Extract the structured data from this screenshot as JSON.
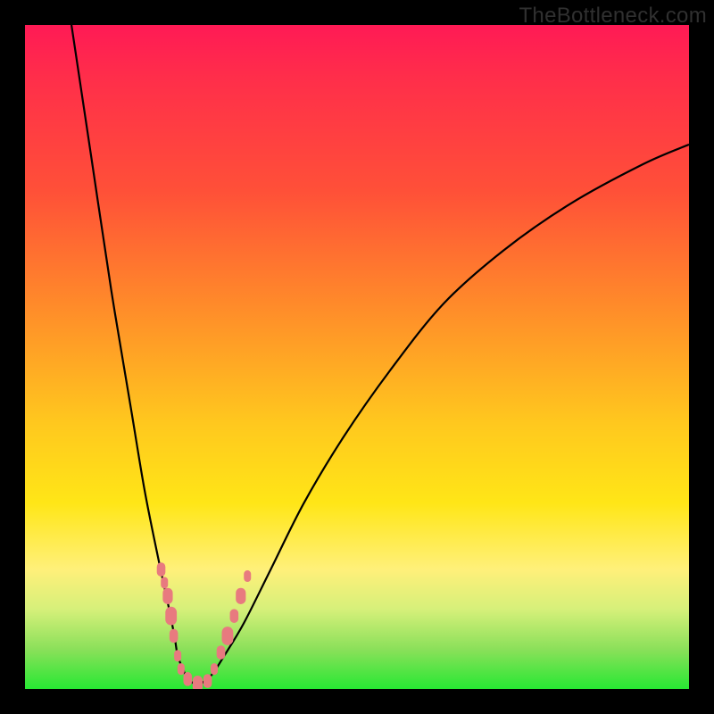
{
  "watermark": "TheBottleneck.com",
  "chart_data": {
    "type": "line",
    "title": "",
    "xlabel": "",
    "ylabel": "",
    "xlim": [
      0,
      100
    ],
    "ylim": [
      0,
      100
    ],
    "grid": false,
    "legend": false,
    "series": [
      {
        "name": "left-branch",
        "x": [
          7,
          10,
          13,
          16,
          18,
          20,
          21.5,
          22.5,
          23,
          23.8,
          24.5,
          26
        ],
        "values": [
          100,
          80,
          60,
          42,
          30,
          20,
          13,
          8,
          5,
          3,
          1.5,
          0.5
        ]
      },
      {
        "name": "right-branch",
        "x": [
          26,
          28,
          30,
          33,
          37,
          42,
          48,
          55,
          63,
          72,
          82,
          93,
          100
        ],
        "values": [
          0.5,
          2,
          5,
          10,
          18,
          28,
          38,
          48,
          58,
          66,
          73,
          79,
          82
        ]
      }
    ],
    "markers": {
      "name": "data-points",
      "color": "#e87a7f",
      "points": [
        {
          "x": 20.5,
          "y": 18,
          "s": 6
        },
        {
          "x": 21.0,
          "y": 16,
          "s": 5
        },
        {
          "x": 21.5,
          "y": 14,
          "s": 7
        },
        {
          "x": 22.0,
          "y": 11,
          "s": 8
        },
        {
          "x": 22.4,
          "y": 8,
          "s": 6
        },
        {
          "x": 23.0,
          "y": 5,
          "s": 5
        },
        {
          "x": 23.5,
          "y": 3,
          "s": 5
        },
        {
          "x": 24.5,
          "y": 1.5,
          "s": 6
        },
        {
          "x": 26.0,
          "y": 0.8,
          "s": 7
        },
        {
          "x": 27.5,
          "y": 1.2,
          "s": 6
        },
        {
          "x": 28.5,
          "y": 3,
          "s": 5
        },
        {
          "x": 29.5,
          "y": 5.5,
          "s": 6
        },
        {
          "x": 30.5,
          "y": 8,
          "s": 8
        },
        {
          "x": 31.5,
          "y": 11,
          "s": 6
        },
        {
          "x": 32.5,
          "y": 14,
          "s": 7
        },
        {
          "x": 33.5,
          "y": 17,
          "s": 5
        }
      ]
    },
    "gradient_stops": [
      {
        "pos": 0,
        "color": "#ff1a55"
      },
      {
        "pos": 8,
        "color": "#ff2e4a"
      },
      {
        "pos": 25,
        "color": "#ff5038"
      },
      {
        "pos": 42,
        "color": "#ff8a2a"
      },
      {
        "pos": 60,
        "color": "#ffc81e"
      },
      {
        "pos": 72,
        "color": "#ffe617"
      },
      {
        "pos": 82,
        "color": "#fff07a"
      },
      {
        "pos": 88,
        "color": "#d6f07a"
      },
      {
        "pos": 94,
        "color": "#8be05a"
      },
      {
        "pos": 100,
        "color": "#27e833"
      }
    ]
  }
}
